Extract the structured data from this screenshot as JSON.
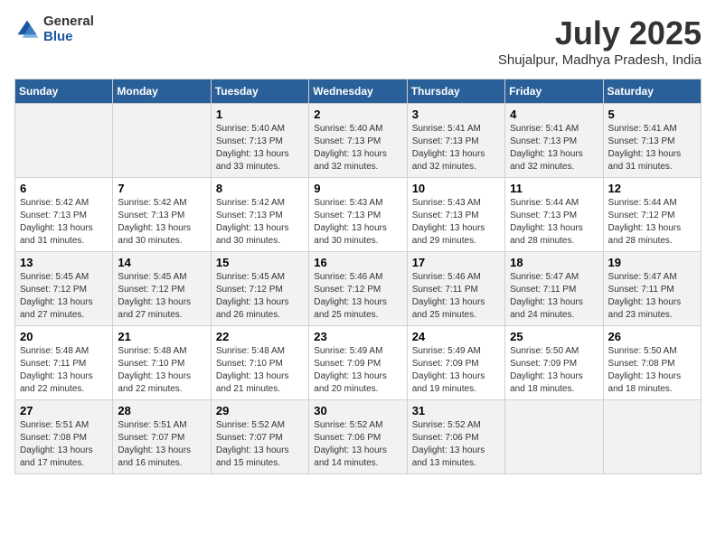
{
  "logo": {
    "general": "General",
    "blue": "Blue"
  },
  "title": "July 2025",
  "location": "Shujalpur, Madhya Pradesh, India",
  "days_of_week": [
    "Sunday",
    "Monday",
    "Tuesday",
    "Wednesday",
    "Thursday",
    "Friday",
    "Saturday"
  ],
  "weeks": [
    [
      {
        "day": "",
        "sunrise": "",
        "sunset": "",
        "daylight": ""
      },
      {
        "day": "",
        "sunrise": "",
        "sunset": "",
        "daylight": ""
      },
      {
        "day": "1",
        "sunrise": "Sunrise: 5:40 AM",
        "sunset": "Sunset: 7:13 PM",
        "daylight": "Daylight: 13 hours and 33 minutes."
      },
      {
        "day": "2",
        "sunrise": "Sunrise: 5:40 AM",
        "sunset": "Sunset: 7:13 PM",
        "daylight": "Daylight: 13 hours and 32 minutes."
      },
      {
        "day": "3",
        "sunrise": "Sunrise: 5:41 AM",
        "sunset": "Sunset: 7:13 PM",
        "daylight": "Daylight: 13 hours and 32 minutes."
      },
      {
        "day": "4",
        "sunrise": "Sunrise: 5:41 AM",
        "sunset": "Sunset: 7:13 PM",
        "daylight": "Daylight: 13 hours and 32 minutes."
      },
      {
        "day": "5",
        "sunrise": "Sunrise: 5:41 AM",
        "sunset": "Sunset: 7:13 PM",
        "daylight": "Daylight: 13 hours and 31 minutes."
      }
    ],
    [
      {
        "day": "6",
        "sunrise": "Sunrise: 5:42 AM",
        "sunset": "Sunset: 7:13 PM",
        "daylight": "Daylight: 13 hours and 31 minutes."
      },
      {
        "day": "7",
        "sunrise": "Sunrise: 5:42 AM",
        "sunset": "Sunset: 7:13 PM",
        "daylight": "Daylight: 13 hours and 30 minutes."
      },
      {
        "day": "8",
        "sunrise": "Sunrise: 5:42 AM",
        "sunset": "Sunset: 7:13 PM",
        "daylight": "Daylight: 13 hours and 30 minutes."
      },
      {
        "day": "9",
        "sunrise": "Sunrise: 5:43 AM",
        "sunset": "Sunset: 7:13 PM",
        "daylight": "Daylight: 13 hours and 30 minutes."
      },
      {
        "day": "10",
        "sunrise": "Sunrise: 5:43 AM",
        "sunset": "Sunset: 7:13 PM",
        "daylight": "Daylight: 13 hours and 29 minutes."
      },
      {
        "day": "11",
        "sunrise": "Sunrise: 5:44 AM",
        "sunset": "Sunset: 7:13 PM",
        "daylight": "Daylight: 13 hours and 28 minutes."
      },
      {
        "day": "12",
        "sunrise": "Sunrise: 5:44 AM",
        "sunset": "Sunset: 7:12 PM",
        "daylight": "Daylight: 13 hours and 28 minutes."
      }
    ],
    [
      {
        "day": "13",
        "sunrise": "Sunrise: 5:45 AM",
        "sunset": "Sunset: 7:12 PM",
        "daylight": "Daylight: 13 hours and 27 minutes."
      },
      {
        "day": "14",
        "sunrise": "Sunrise: 5:45 AM",
        "sunset": "Sunset: 7:12 PM",
        "daylight": "Daylight: 13 hours and 27 minutes."
      },
      {
        "day": "15",
        "sunrise": "Sunrise: 5:45 AM",
        "sunset": "Sunset: 7:12 PM",
        "daylight": "Daylight: 13 hours and 26 minutes."
      },
      {
        "day": "16",
        "sunrise": "Sunrise: 5:46 AM",
        "sunset": "Sunset: 7:12 PM",
        "daylight": "Daylight: 13 hours and 25 minutes."
      },
      {
        "day": "17",
        "sunrise": "Sunrise: 5:46 AM",
        "sunset": "Sunset: 7:11 PM",
        "daylight": "Daylight: 13 hours and 25 minutes."
      },
      {
        "day": "18",
        "sunrise": "Sunrise: 5:47 AM",
        "sunset": "Sunset: 7:11 PM",
        "daylight": "Daylight: 13 hours and 24 minutes."
      },
      {
        "day": "19",
        "sunrise": "Sunrise: 5:47 AM",
        "sunset": "Sunset: 7:11 PM",
        "daylight": "Daylight: 13 hours and 23 minutes."
      }
    ],
    [
      {
        "day": "20",
        "sunrise": "Sunrise: 5:48 AM",
        "sunset": "Sunset: 7:11 PM",
        "daylight": "Daylight: 13 hours and 22 minutes."
      },
      {
        "day": "21",
        "sunrise": "Sunrise: 5:48 AM",
        "sunset": "Sunset: 7:10 PM",
        "daylight": "Daylight: 13 hours and 22 minutes."
      },
      {
        "day": "22",
        "sunrise": "Sunrise: 5:48 AM",
        "sunset": "Sunset: 7:10 PM",
        "daylight": "Daylight: 13 hours and 21 minutes."
      },
      {
        "day": "23",
        "sunrise": "Sunrise: 5:49 AM",
        "sunset": "Sunset: 7:09 PM",
        "daylight": "Daylight: 13 hours and 20 minutes."
      },
      {
        "day": "24",
        "sunrise": "Sunrise: 5:49 AM",
        "sunset": "Sunset: 7:09 PM",
        "daylight": "Daylight: 13 hours and 19 minutes."
      },
      {
        "day": "25",
        "sunrise": "Sunrise: 5:50 AM",
        "sunset": "Sunset: 7:09 PM",
        "daylight": "Daylight: 13 hours and 18 minutes."
      },
      {
        "day": "26",
        "sunrise": "Sunrise: 5:50 AM",
        "sunset": "Sunset: 7:08 PM",
        "daylight": "Daylight: 13 hours and 18 minutes."
      }
    ],
    [
      {
        "day": "27",
        "sunrise": "Sunrise: 5:51 AM",
        "sunset": "Sunset: 7:08 PM",
        "daylight": "Daylight: 13 hours and 17 minutes."
      },
      {
        "day": "28",
        "sunrise": "Sunrise: 5:51 AM",
        "sunset": "Sunset: 7:07 PM",
        "daylight": "Daylight: 13 hours and 16 minutes."
      },
      {
        "day": "29",
        "sunrise": "Sunrise: 5:52 AM",
        "sunset": "Sunset: 7:07 PM",
        "daylight": "Daylight: 13 hours and 15 minutes."
      },
      {
        "day": "30",
        "sunrise": "Sunrise: 5:52 AM",
        "sunset": "Sunset: 7:06 PM",
        "daylight": "Daylight: 13 hours and 14 minutes."
      },
      {
        "day": "31",
        "sunrise": "Sunrise: 5:52 AM",
        "sunset": "Sunset: 7:06 PM",
        "daylight": "Daylight: 13 hours and 13 minutes."
      },
      {
        "day": "",
        "sunrise": "",
        "sunset": "",
        "daylight": ""
      },
      {
        "day": "",
        "sunrise": "",
        "sunset": "",
        "daylight": ""
      }
    ]
  ]
}
